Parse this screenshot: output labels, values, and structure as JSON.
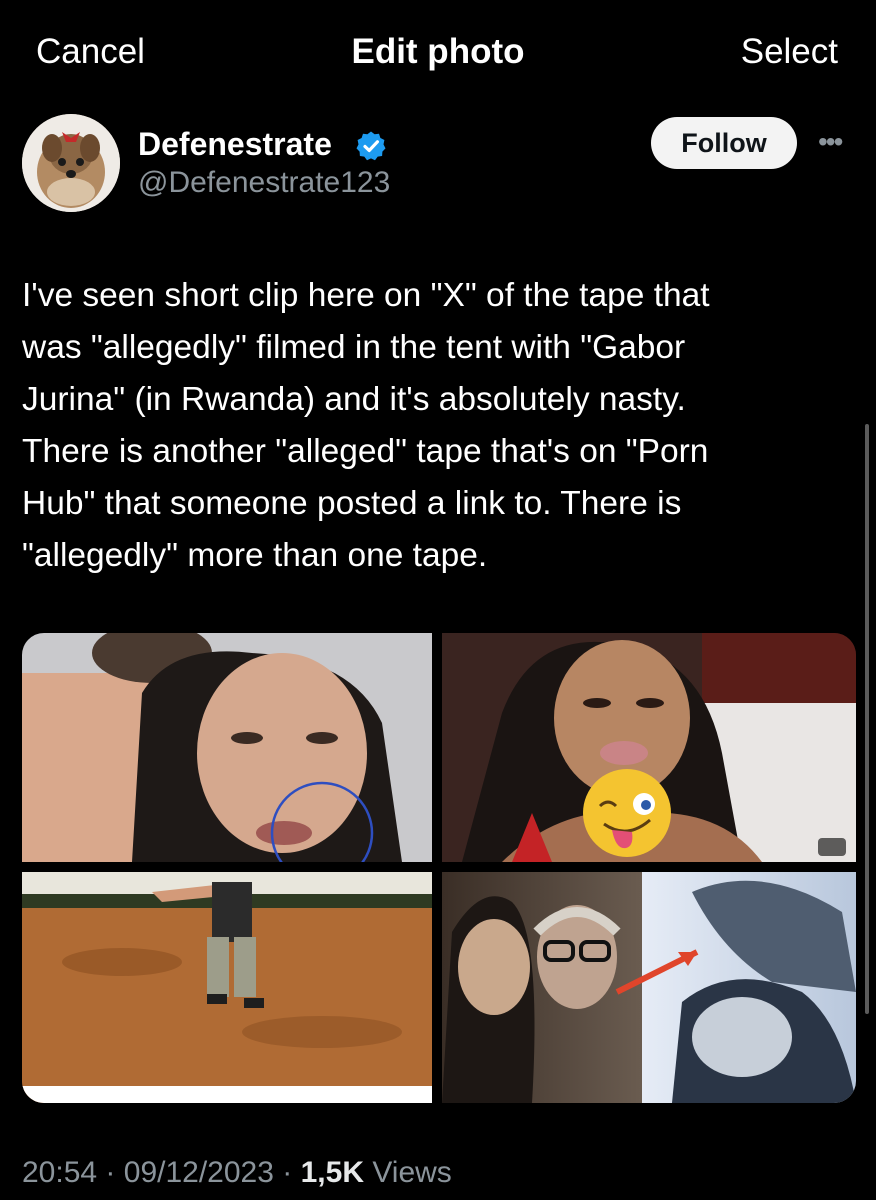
{
  "header": {
    "cancel_label": "Cancel",
    "title": "Edit photo",
    "select_label": "Select"
  },
  "author": {
    "name": "Defenestrate",
    "handle": "@Defenestrate123",
    "verified": true,
    "follow_label": "Follow",
    "more_icon": "ellipsis-icon"
  },
  "tweet": {
    "text": "I've seen short clip here on \"X\" of the tape that\nwas \"allegedly\" filmed in the tent with \"Gabor\nJurina\" (in Rwanda) and it's absolutely nasty.\nThere is another \"alleged\" tape that's on \"Porn\nHub\" that someone posted a link to. There is\n\"allegedly\" more than one tape."
  },
  "media": {
    "count": 4,
    "tiles": [
      {
        "id": "photo-1",
        "icon": "photo"
      },
      {
        "id": "photo-2",
        "icon": "photo",
        "overlay_emoji": "winking-tongue-emoji"
      },
      {
        "id": "photo-3",
        "icon": "photo"
      },
      {
        "id": "photo-4",
        "icon": "photo",
        "annotation": "red-arrow"
      }
    ]
  },
  "footer": {
    "time": "20:54",
    "date": "09/12/2023",
    "sep": "·",
    "views_count": "1,5K",
    "views_label": "Views"
  },
  "colors": {
    "background": "#000000",
    "text": "#ffffff",
    "secondary": "#8b949b",
    "verified_blue": "#1d9bf0",
    "follow_bg": "#f3f3f3"
  }
}
